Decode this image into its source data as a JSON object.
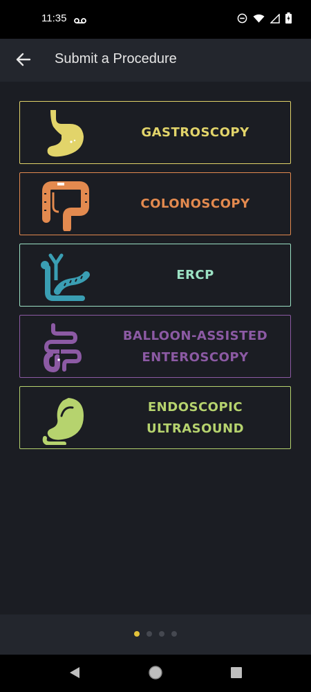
{
  "status_bar": {
    "time": "11:35",
    "icons": [
      "voicemail-icon",
      "do-not-disturb-icon",
      "wifi-icon",
      "signal-icon",
      "battery-icon"
    ]
  },
  "app_bar": {
    "title": "Submit a Procedure",
    "back_icon": "arrow-left-icon"
  },
  "procedures": [
    {
      "line1": "GASTROSCOPY",
      "line2": "",
      "color": "#e2d46a",
      "icon": "stomach-icon"
    },
    {
      "line1": "COLONOSCOPY",
      "line2": "",
      "color": "#e38a4f",
      "icon": "colon-icon"
    },
    {
      "line1": "ERCP",
      "line2": "",
      "color": "#9ce2c4",
      "icon": "pancreas-bile-duct-icon"
    },
    {
      "line1": "BALLOON-ASSISTED",
      "line2": "ENTEROSCOPY",
      "color": "#8c5aa4",
      "icon": "small-intestine-icon"
    },
    {
      "line1": "ENDOSCOPIC",
      "line2": "ULTRASOUND",
      "color": "#b6d36e",
      "icon": "ultrasound-stomach-icon"
    }
  ],
  "pager": {
    "count": 4,
    "active": 1,
    "active_color": "#e2c23a"
  },
  "nav_bar": {
    "icons": [
      "back-triangle-icon",
      "home-circle-icon",
      "recents-square-icon"
    ]
  }
}
